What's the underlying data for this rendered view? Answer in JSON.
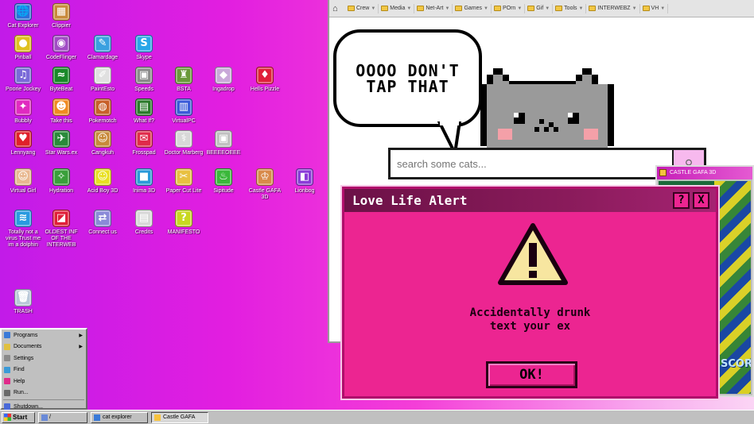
{
  "desktop_icons": [
    {
      "label": "Cat Explorer",
      "glyph": "🌐",
      "color": "#2c6fd8"
    },
    {
      "label": "Clippier",
      "glyph": "▦",
      "color": "#c88a3a"
    },
    {
      "label": "Pinball",
      "glyph": "●",
      "color": "#e0c020"
    },
    {
      "label": "CodeFlinger",
      "glyph": "◉",
      "color": "#a14cc5"
    },
    {
      "label": "Clamardage",
      "glyph": "✎",
      "color": "#3aa0e0"
    },
    {
      "label": "Skype",
      "glyph": "S",
      "color": "#2aa6e8"
    },
    {
      "label": "Poorie Jockey",
      "glyph": "♫",
      "color": "#7a6ad8"
    },
    {
      "label": "ByteBeat",
      "glyph": "≈",
      "color": "#1a8a2a"
    },
    {
      "label": "PaintEsto",
      "glyph": "✐",
      "color": "#e0e0e0"
    },
    {
      "label": "Speeds",
      "glyph": "▣",
      "color": "#8a8a8a"
    },
    {
      "label": "BSTA",
      "glyph": "♜",
      "color": "#6a9a3a"
    },
    {
      "label": "Ingadrop",
      "glyph": "◆",
      "color": "#c9a9d9"
    },
    {
      "label": "Hells Pizzle",
      "glyph": "♦",
      "color": "#e0203a"
    },
    {
      "label": "Bubbly",
      "glyph": "✦",
      "color": "#e02ac0"
    },
    {
      "label": "Take this",
      "glyph": "☻",
      "color": "#f08a20"
    },
    {
      "label": "Pokemotch",
      "glyph": "◍",
      "color": "#c8602a"
    },
    {
      "label": "What If?",
      "glyph": "▤",
      "color": "#2a7a2a"
    },
    {
      "label": "VirtualPC",
      "glyph": "▥",
      "color": "#3a5ad8"
    },
    {
      "label": "Lennyang",
      "glyph": "♥",
      "color": "#e0202a"
    },
    {
      "label": "Star Wars.ex",
      "glyph": "✈",
      "color": "#2a8a3a"
    },
    {
      "label": "Cangkuh",
      "glyph": "☺",
      "color": "#c88a3a"
    },
    {
      "label": "Frosspad",
      "glyph": "✉",
      "color": "#e02a4a"
    },
    {
      "label": "Doctor Marberg",
      "glyph": "⚕",
      "color": "#d8d8d8"
    },
    {
      "label": "BEEEEOEEE",
      "glyph": "▣",
      "color": "#c0c0c0"
    },
    {
      "label": "Virtual Girl",
      "glyph": "☺",
      "color": "#e8b890"
    },
    {
      "label": "Hydration",
      "glyph": "✧",
      "color": "#3aa03a"
    },
    {
      "label": "Acid Boy 3D",
      "glyph": "☺",
      "color": "#e8e020"
    },
    {
      "label": "Inima 3D",
      "glyph": "■",
      "color": "#2a9ad8"
    },
    {
      "label": "Paper Cut Lite",
      "glyph": "✂",
      "color": "#e8c040"
    },
    {
      "label": "Sipitude",
      "glyph": "♨",
      "color": "#3ab83a"
    },
    {
      "label": "Castle GAFA 3D",
      "glyph": "♔",
      "color": "#d88a4a"
    },
    {
      "label": "Lionbog",
      "glyph": "◧",
      "color": "#8a3ad8"
    },
    {
      "label": "Totally not a virus Trust me im a dolphin",
      "glyph": "≋",
      "color": "#2a9ae0"
    },
    {
      "label": "OLDEST INF OF THE INTERWEB",
      "glyph": "◪",
      "color": "#e0203a"
    },
    {
      "label": "Connect us",
      "glyph": "⇄",
      "color": "#8a8ad8"
    },
    {
      "label": "Credits",
      "glyph": "▤",
      "color": "#d8d8d8"
    },
    {
      "label": "MANIFESTO",
      "glyph": "?",
      "color": "#c8d820"
    },
    {
      "label": "TRASH",
      "glyph": "🗑",
      "color": "#b8c8d8"
    }
  ],
  "browser": {
    "bookmarks": [
      "Crew",
      "Media",
      "Net-Art",
      "Games",
      "POrn",
      "Gif",
      "Tools",
      "INTERWEBZ",
      "VH"
    ],
    "speech_bubble": "OOOO DON'T\nTAP THAT",
    "search_placeholder": "search some cats...",
    "search_icon": "search-icon"
  },
  "castle_window": {
    "title": "CASTLE GAFA 3D",
    "score_label": "SCORE"
  },
  "alert": {
    "title": "Love Life Alert",
    "help_label": "?",
    "close_label": "X",
    "message": "Accidentally drunk\ntext your ex",
    "ok_label": "OK!",
    "accent": "#ec2591"
  },
  "start_menu": {
    "items": [
      {
        "label": "Programs",
        "submenu": true,
        "color": "#3a7ad8"
      },
      {
        "label": "Documents",
        "submenu": true,
        "color": "#e0c040"
      },
      {
        "label": "Settings",
        "submenu": false,
        "color": "#8a8a8a"
      },
      {
        "label": "Find",
        "submenu": false,
        "color": "#3a9ad8"
      },
      {
        "label": "Help",
        "submenu": false,
        "color": "#e02a8a"
      },
      {
        "label": "Run...",
        "submenu": false,
        "color": "#6a6a6a"
      }
    ],
    "shutdown_label": "Shutdown..."
  },
  "taskbar": {
    "start_label": "Start",
    "quicklaunch_label": "/",
    "tasks": [
      {
        "label": "cat explorer",
        "active": false
      },
      {
        "label": "Castle GAFA",
        "active": true
      }
    ]
  }
}
